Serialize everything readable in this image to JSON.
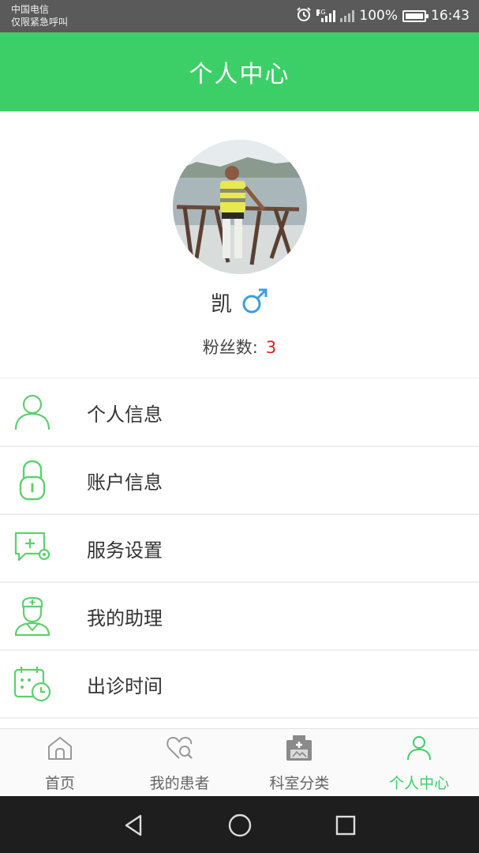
{
  "status_bar": {
    "carrier_line1": "中国电信",
    "carrier_line2": "仅限紧急呼叫",
    "network_tag": "4G",
    "battery": "100%",
    "time": "16:43"
  },
  "header": {
    "title": "个人中心"
  },
  "profile": {
    "name": "凯",
    "gender_icon": "male-icon",
    "fans_label": "粉丝数:",
    "fans_count": "3"
  },
  "menu": {
    "items": [
      {
        "label": "个人信息",
        "icon": "person-icon"
      },
      {
        "label": "账户信息",
        "icon": "lock-icon"
      },
      {
        "label": "服务设置",
        "icon": "chat-settings-icon"
      },
      {
        "label": "我的助理",
        "icon": "nurse-icon"
      },
      {
        "label": "出诊时间",
        "icon": "calendar-clock-icon"
      }
    ]
  },
  "tabs": [
    {
      "label": "首页",
      "icon": "home-icon",
      "active": false
    },
    {
      "label": "我的患者",
      "icon": "heart-search-icon",
      "active": false
    },
    {
      "label": "科室分类",
      "icon": "medical-bag-icon",
      "active": false
    },
    {
      "label": "个人中心",
      "icon": "person-icon",
      "active": true
    }
  ],
  "colors": {
    "accent": "#3ccf68",
    "menu_icon": "#5fcf6f",
    "fans_count": "#e02020",
    "gender": "#3b9ee0"
  }
}
